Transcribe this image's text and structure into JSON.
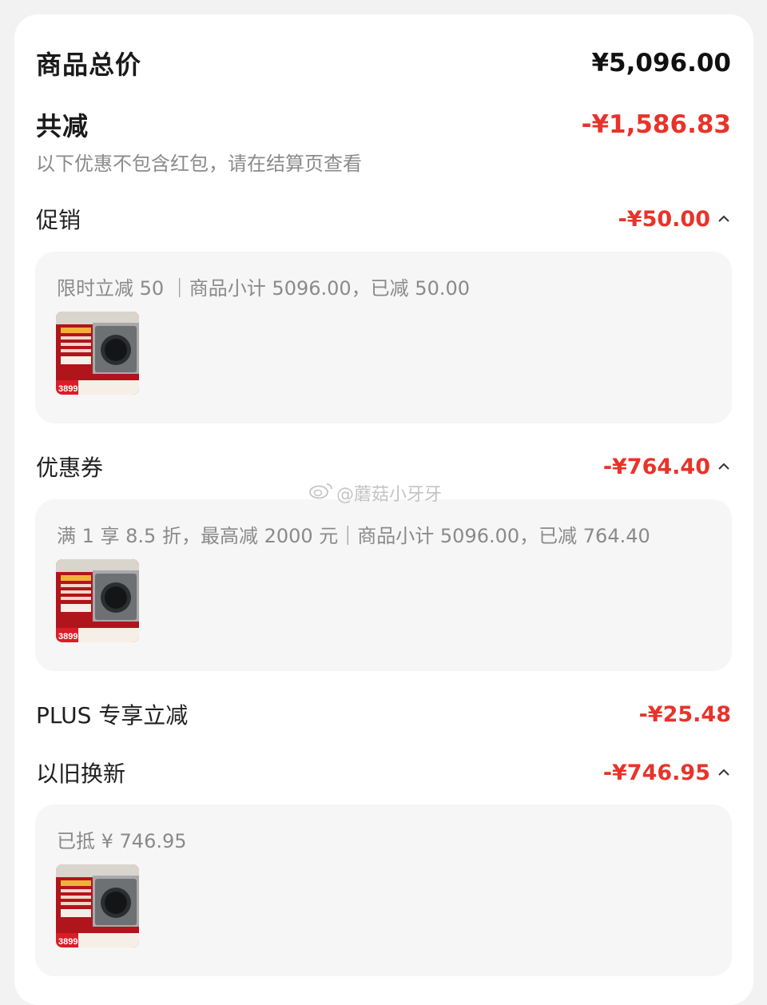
{
  "summary": {
    "total_label": "商品总价",
    "total_value": "¥5,096.00",
    "discount_label": "共减",
    "discount_value": "-¥1,586.83",
    "note": "以下优惠不包含红包，请在结算页查看"
  },
  "promotion": {
    "label": "促销",
    "value": "-¥50.00",
    "detail": "限时立减 50 ｜商品小计 5096.00，已减 50.00",
    "thumb_price": "3899"
  },
  "coupon": {
    "label": "优惠券",
    "value": "-¥764.40",
    "detail": "满 1 享 8.5 折，最高减 2000 元｜商品小计 5096.00，已减 764.40",
    "thumb_price": "3899"
  },
  "plus": {
    "label": "PLUS 专享立减",
    "value": "-¥25.48"
  },
  "tradein": {
    "label": "以旧换新",
    "value": "-¥746.95",
    "detail": "已抵 ¥ 746.95",
    "thumb_price": "3899"
  },
  "watermark": "@蘑菇小牙牙",
  "icons": {
    "chevron": "chevron-up-icon",
    "weibo": "weibo-icon"
  },
  "colors": {
    "accent_red": "#e8332a",
    "text_dark": "#1a1a1a",
    "text_gray": "#8a8a8a",
    "box_bg": "#f6f6f6"
  }
}
